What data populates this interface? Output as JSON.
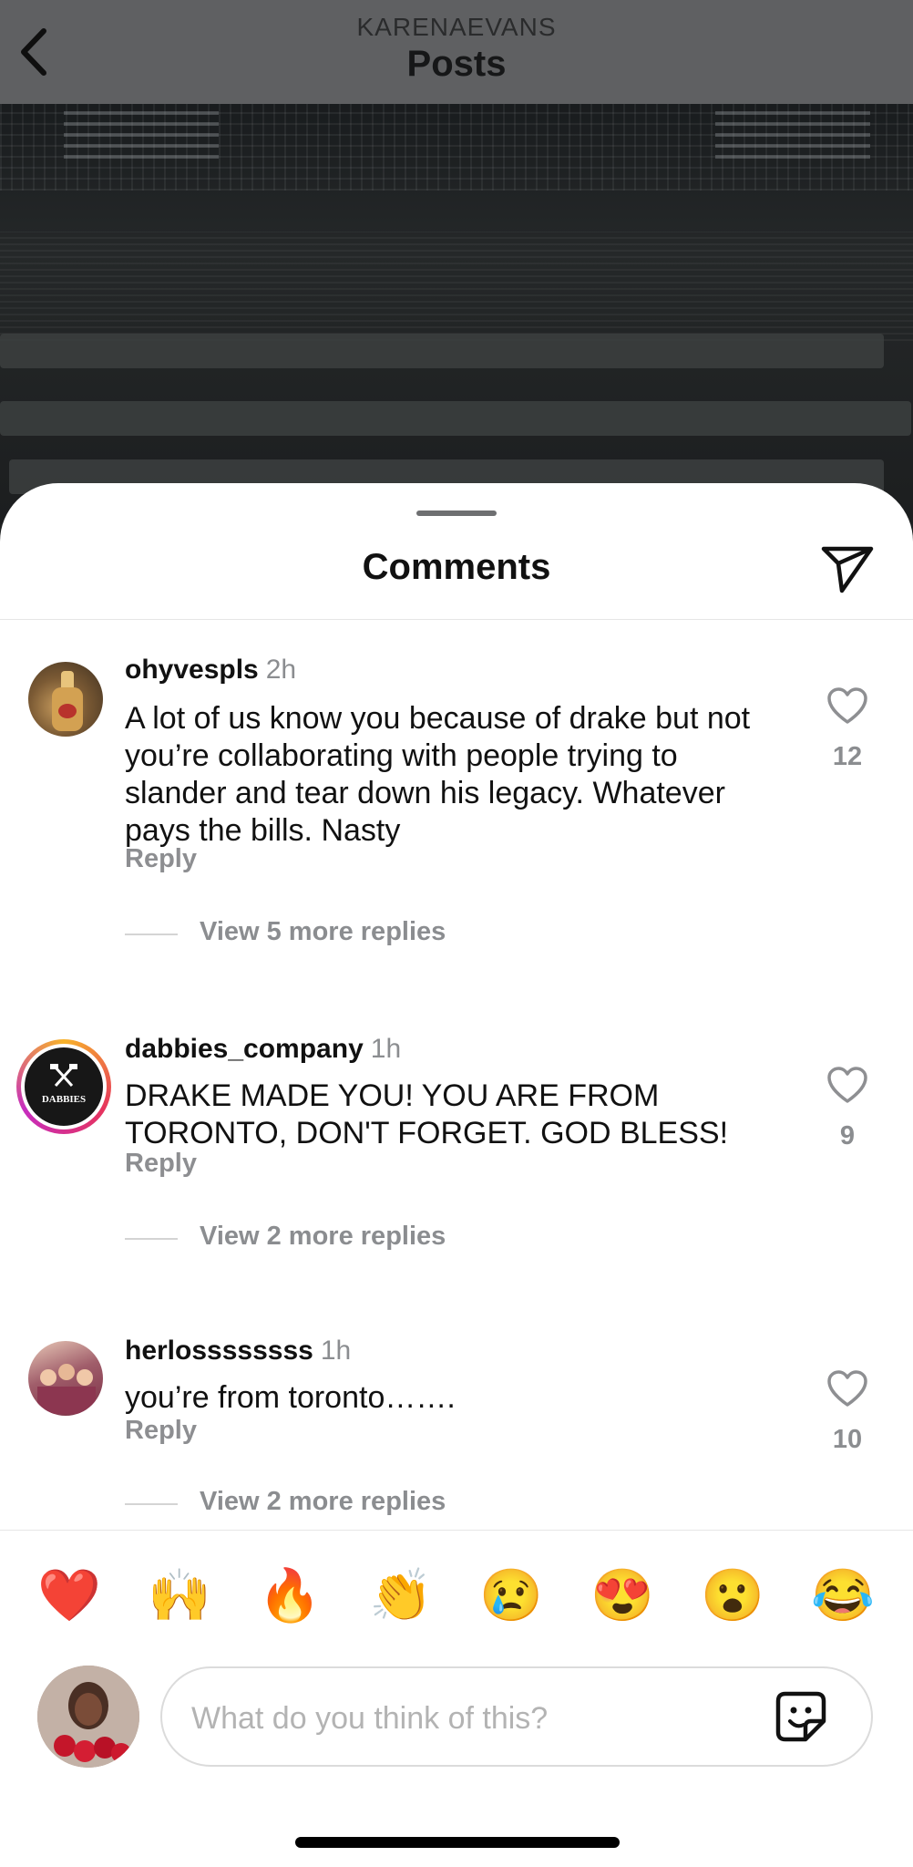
{
  "header": {
    "owner": "KARENAEVANS",
    "title": "Posts"
  },
  "sheet": {
    "title": "Comments"
  },
  "comments": [
    {
      "username": "ohyvespls",
      "time": "2h",
      "text": "A lot of us know you because of drake but not you’re collaborating with people trying to slander and tear down his legacy. Whatever pays the bills. Nasty",
      "reply_label": "Reply",
      "likes": "12",
      "view_replies": "View 5 more replies"
    },
    {
      "username": "dabbies_company",
      "time": "1h",
      "text": "DRAKE MADE YOU! YOU ARE FROM TORONTO, DON'T FORGET. GOD BLESS!",
      "reply_label": "Reply",
      "likes": "9",
      "view_replies": "View 2 more replies",
      "avatar_text": "DABBIES"
    },
    {
      "username": "herlossssssss",
      "time": "1h",
      "text": "you’re from toronto…….",
      "reply_label": "Reply",
      "likes": "10",
      "view_replies": "View 2 more replies"
    }
  ],
  "emojis": [
    "❤️",
    "🙌",
    "🔥",
    "👏",
    "😢",
    "😍",
    "😮",
    "😂"
  ],
  "composer": {
    "placeholder": "What do you think of this?"
  },
  "icons": {
    "back": "chevron-left-icon",
    "share": "paper-plane-icon",
    "like": "heart-outline-icon",
    "sticker": "sticker-icon"
  }
}
